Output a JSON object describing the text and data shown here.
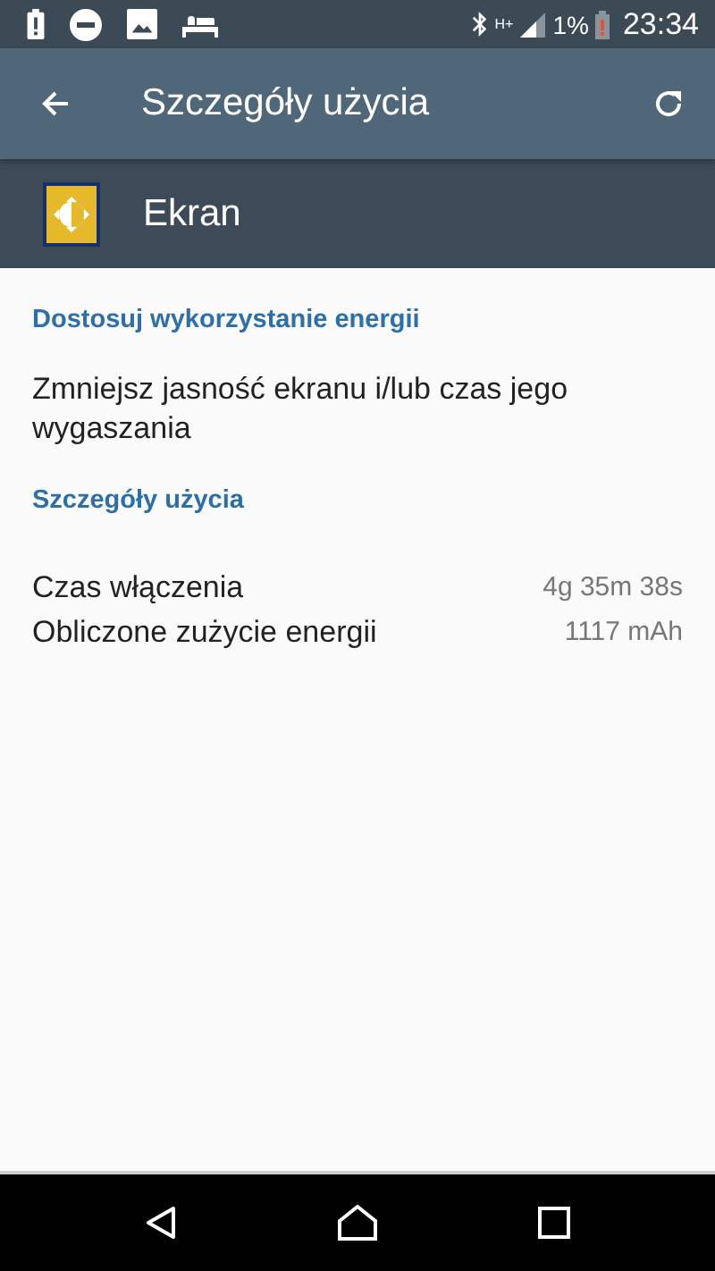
{
  "status_bar": {
    "battery_percent": "1%",
    "time": "23:34",
    "network": "H+"
  },
  "toolbar": {
    "title": "Szczegóły użycia"
  },
  "app_header": {
    "name": "Ekran"
  },
  "sections": [
    {
      "heading": "Dostosuj wykorzystanie energii",
      "kind": "text",
      "text": "Zmniejsz jasność ekranu i/lub czas jego wygaszania"
    },
    {
      "heading": "Szczegóły użycia",
      "kind": "details",
      "rows": [
        {
          "label": "Czas włączenia",
          "value": "4g 35m 38s"
        },
        {
          "label": "Obliczone zużycie energii",
          "value": "1117 mAh"
        }
      ]
    }
  ]
}
